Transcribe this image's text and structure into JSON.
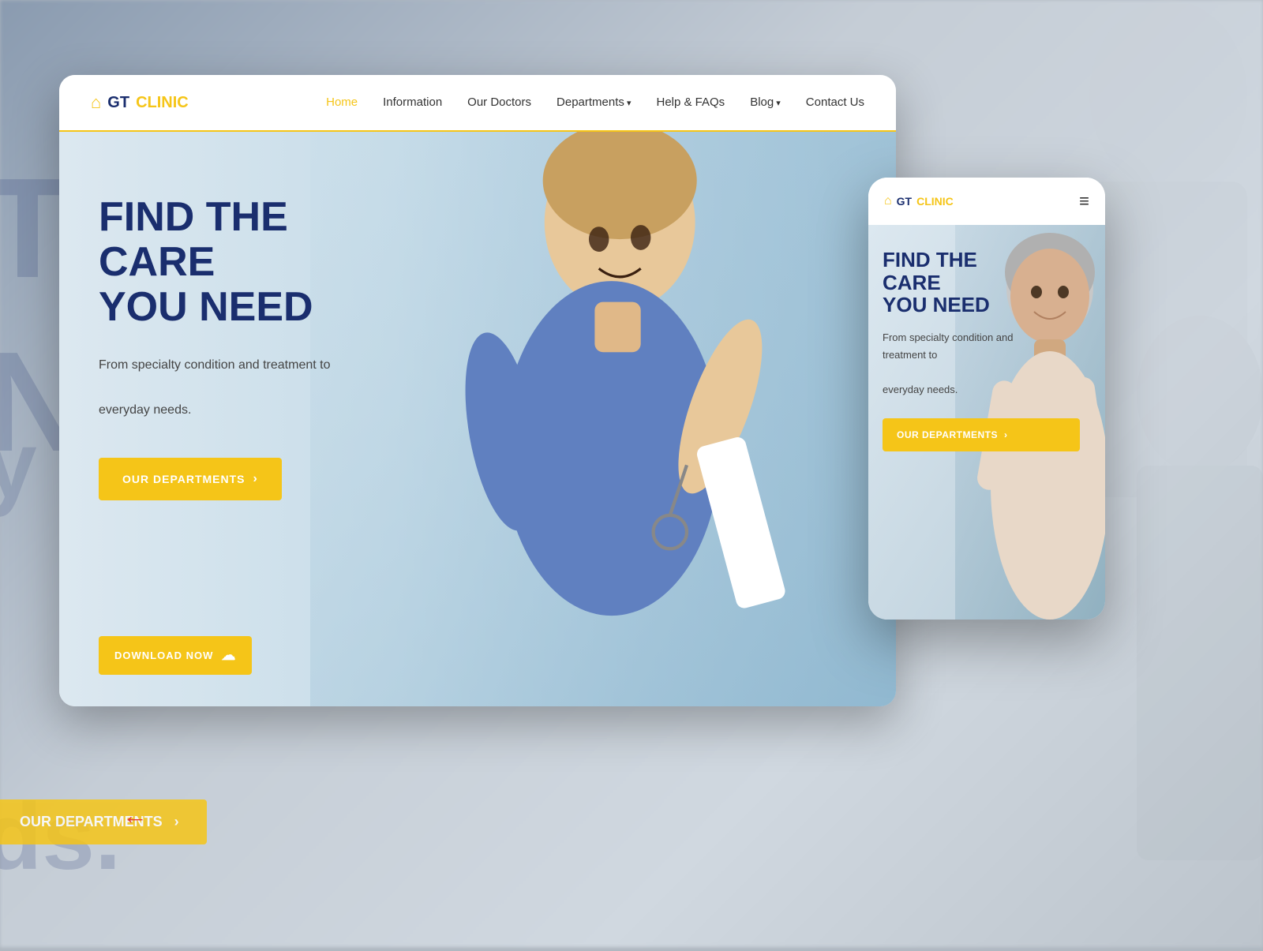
{
  "page": {
    "background_text_1": "TH",
    "background_text_2": "NE",
    "background_text_co": "y co",
    "background_text_ds": "ds."
  },
  "desktop": {
    "logo": {
      "icon": "🏠",
      "gt": "GT",
      "clinic": "CLINIC"
    },
    "nav": {
      "links": [
        {
          "label": "Home",
          "active": true,
          "has_dropdown": false
        },
        {
          "label": "Information",
          "active": false,
          "has_dropdown": false
        },
        {
          "label": "Our Doctors",
          "active": false,
          "has_dropdown": false
        },
        {
          "label": "Departments",
          "active": false,
          "has_dropdown": true
        },
        {
          "label": "Help & FAQs",
          "active": false,
          "has_dropdown": false
        },
        {
          "label": "Blog",
          "active": false,
          "has_dropdown": true
        },
        {
          "label": "Contact Us",
          "active": false,
          "has_dropdown": false
        }
      ]
    },
    "hero": {
      "title_line1": "FIND THE CARE",
      "title_line2": "YOU NEED",
      "subtitle": "From specialty condition and treatment to",
      "subtitle2": "everyday needs.",
      "cta_label": "OUR DEPARTMENTS",
      "download_label": "DOWNLOAD NOW"
    }
  },
  "mobile": {
    "logo": {
      "icon": "🏠",
      "gt": "GT",
      "clinic": "CLINIC"
    },
    "hero": {
      "title_line1": "FIND THE CARE",
      "title_line2": "YOU NEED",
      "subtitle": "From specialty condition and treatment to",
      "subtitle2": "everyday needs.",
      "cta_label": "OUR DEPARTMENTS"
    }
  },
  "icons": {
    "chevron_right": "›",
    "hamburger": "≡",
    "cloud": "☁",
    "arrow_right": "→"
  },
  "colors": {
    "primary_blue": "#1a2e6e",
    "accent_yellow": "#f5c518",
    "bg_hero": "#dce8f0",
    "text_dark": "#333333",
    "text_gray": "#444444"
  }
}
